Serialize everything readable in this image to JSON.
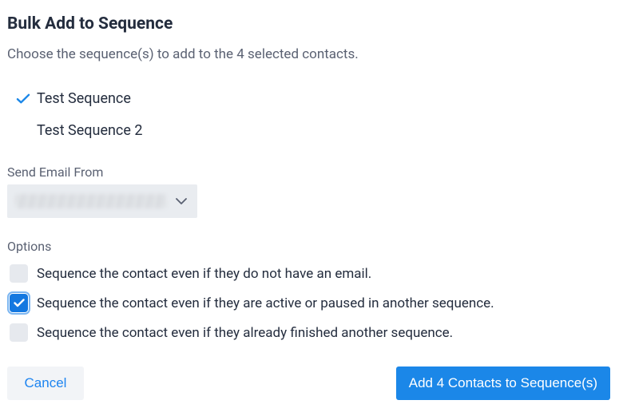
{
  "title": "Bulk Add to Sequence",
  "subtitle": "Choose the sequence(s) to add to the 4 selected contacts.",
  "sequences": [
    {
      "label": "Test Sequence",
      "selected": true
    },
    {
      "label": "Test Sequence 2",
      "selected": false
    }
  ],
  "send_from_label": "Send Email From",
  "options_label": "Options",
  "options": [
    {
      "label": "Sequence the contact even if they do not have an email.",
      "checked": false
    },
    {
      "label": "Sequence the contact even if they are active or paused in another sequence.",
      "checked": true
    },
    {
      "label": "Sequence the contact even if they already finished another sequence.",
      "checked": false
    }
  ],
  "buttons": {
    "cancel": "Cancel",
    "submit": "Add 4 Contacts to Sequence(s)"
  },
  "colors": {
    "primary": "#1b87e8",
    "text": "#242d3e",
    "muted": "#5a6172"
  }
}
